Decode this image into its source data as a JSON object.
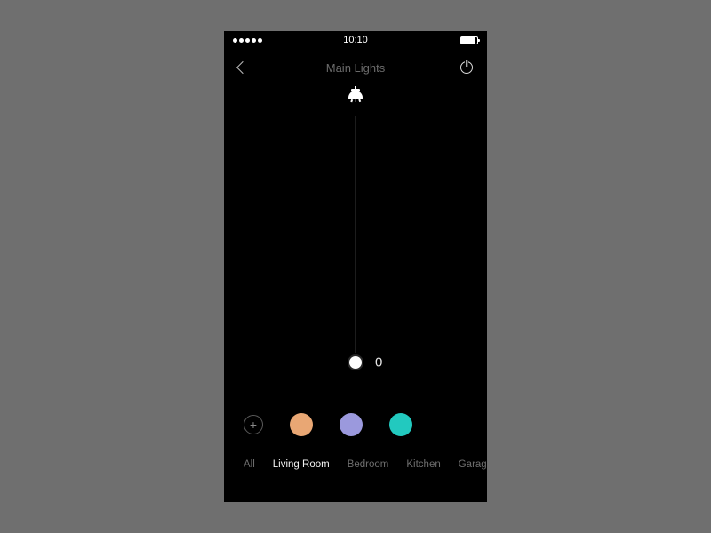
{
  "status": {
    "time": "10:10"
  },
  "header": {
    "title": "Main Lights"
  },
  "slider": {
    "value": "0",
    "position_pct": 99
  },
  "colors": {
    "swatches": [
      {
        "hex": "#e9a774"
      },
      {
        "hex": "#9b99dd"
      },
      {
        "hex": "#22c9bf"
      }
    ]
  },
  "rooms": {
    "items": [
      {
        "label": "All",
        "active": false
      },
      {
        "label": "Living Room",
        "active": true
      },
      {
        "label": "Bedroom",
        "active": false
      },
      {
        "label": "Kitchen",
        "active": false
      },
      {
        "label": "Garage",
        "active": false
      }
    ]
  }
}
